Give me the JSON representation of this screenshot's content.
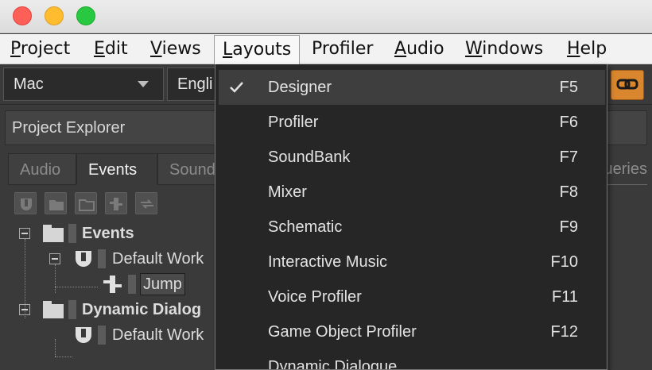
{
  "menubar": {
    "items": [
      {
        "first": "P",
        "rest": "roject"
      },
      {
        "first": "E",
        "rest": "dit"
      },
      {
        "first": "V",
        "rest": "iews"
      },
      {
        "first": "L",
        "rest": "ayouts"
      },
      {
        "first": "",
        "rest": "Profiler"
      },
      {
        "first": "A",
        "rest": "udio"
      },
      {
        "first": "W",
        "rest": "indows"
      },
      {
        "first": "H",
        "rest": "elp"
      }
    ]
  },
  "toolbar": {
    "platform": "Mac",
    "language": "Engli"
  },
  "panel": {
    "title": "Project Explorer",
    "tabs": [
      "Audio",
      "Events",
      "Sound"
    ],
    "tab_right": "ueries"
  },
  "tree": {
    "events": "Events",
    "default_work_1": "Default Work",
    "jump": "Jump",
    "dynamic_dialogue": "Dynamic Dialog",
    "default_work_2": "Default Work"
  },
  "dropdown": {
    "items": [
      {
        "label": "Designer",
        "key": "F5",
        "checked": true
      },
      {
        "label": "Profiler",
        "key": "F6"
      },
      {
        "label": "SoundBank",
        "key": "F7"
      },
      {
        "label": "Mixer",
        "key": "F8"
      },
      {
        "label": "Schematic",
        "key": "F9"
      },
      {
        "label": "Interactive Music",
        "key": "F10"
      },
      {
        "label": "Voice Profiler",
        "key": "F11"
      },
      {
        "label": "Game Object Profiler",
        "key": "F12"
      },
      {
        "label": "Dynamic Dialogue",
        "key": ""
      }
    ]
  },
  "colors": {
    "accent": "#d9862f",
    "menu_bg": "#262626"
  }
}
